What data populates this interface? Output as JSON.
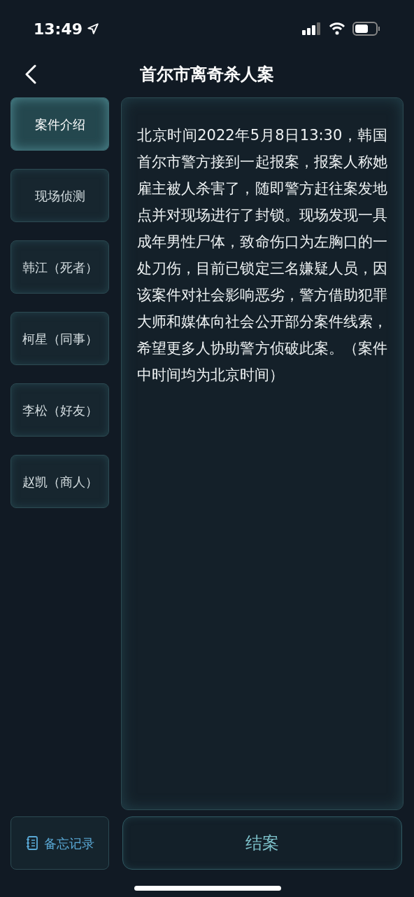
{
  "status_bar": {
    "time": "13:49"
  },
  "header": {
    "title": "首尔市离奇杀人案"
  },
  "tabs": [
    {
      "label": "案件介绍",
      "selected": true
    },
    {
      "label": "现场侦测",
      "selected": false
    },
    {
      "label": "韩江（死者）",
      "selected": false
    },
    {
      "label": "柯星（同事）",
      "selected": false
    },
    {
      "label": "李松（好友）",
      "selected": false
    },
    {
      "label": "赵凯（商人）",
      "selected": false
    }
  ],
  "content": {
    "text": "北京时间2022年5月8日13:30，韩国首尔市警方接到一起报案，报案人称她雇主被人杀害了，随即警方赶往案发地点并对现场进行了封锁。现场发现一具成年男性尸体，致命伤口为左胸口的一处刀伤，目前已锁定三名嫌疑人员，因该案件对社会影响恶劣，警方借助犯罪大师和媒体向社会公开部分案件线索，希望更多人协助警方侦破此案。（案件中时间均为北京时间）"
  },
  "footer": {
    "memo_button": "备忘记录",
    "close_case_button": "结案"
  }
}
